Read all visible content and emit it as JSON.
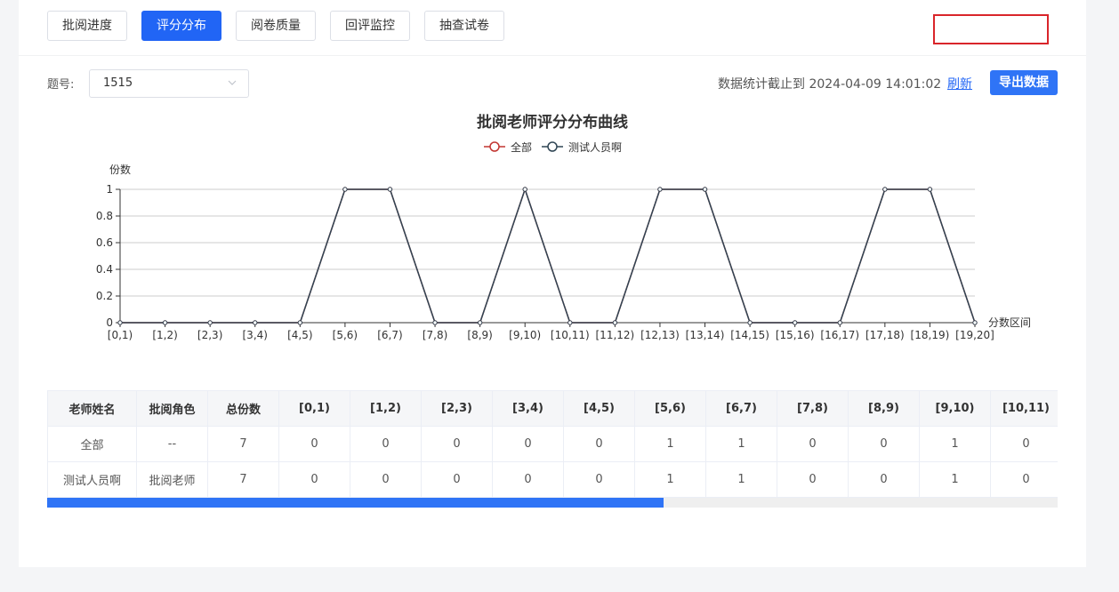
{
  "tabs": [
    {
      "label": "批阅进度",
      "active": false
    },
    {
      "label": "评分分布",
      "active": true
    },
    {
      "label": "阅卷质量",
      "active": false
    },
    {
      "label": "回评监控",
      "active": false
    },
    {
      "label": "抽查试卷",
      "active": false
    }
  ],
  "filter": {
    "question_label": "题号:",
    "question_value": "1515"
  },
  "stats": {
    "text": "数据统计截止到 2024-04-09 14:01:02",
    "refresh_label": "刷新",
    "export_label": "导出数据"
  },
  "colors": {
    "accent": "#2165f5",
    "series_all": "#c23531",
    "series_teacher": "#2f4554"
  },
  "chart_data": {
    "type": "line",
    "title": "批阅老师评分分布曲线",
    "xlabel": "分数区间",
    "ylabel": "份数",
    "ylim": [
      0,
      1
    ],
    "yticks": [
      "0",
      "0.2",
      "0.4",
      "0.6",
      "0.8",
      "1"
    ],
    "categories": [
      "[0,1)",
      "[1,2)",
      "[2,3)",
      "[3,4)",
      "[4,5)",
      "[5,6)",
      "[6,7)",
      "[7,8)",
      "[8,9)",
      "[9,10)",
      "[10,11)",
      "[11,12)",
      "[12,13)",
      "[13,14)",
      "[14,15)",
      "[15,16)",
      "[16,17)",
      "[17,18)",
      "[18,19)",
      "[19,20]"
    ],
    "series": [
      {
        "name": "全部",
        "values": [
          0,
          0,
          0,
          0,
          0,
          1,
          1,
          0,
          0,
          1,
          0,
          0,
          1,
          1,
          0,
          0,
          0,
          1,
          1,
          0
        ]
      },
      {
        "name": "测试人员啊",
        "values": [
          0,
          0,
          0,
          0,
          0,
          1,
          1,
          0,
          0,
          1,
          0,
          0,
          1,
          1,
          0,
          0,
          0,
          1,
          1,
          0
        ]
      }
    ],
    "grid": true,
    "legend": "top-center"
  },
  "table": {
    "headers": [
      "老师姓名",
      "批阅角色",
      "总份数",
      "[0,1)",
      "[1,2)",
      "[2,3)",
      "[3,4)",
      "[4,5)",
      "[5,6)",
      "[6,7)",
      "[7,8)",
      "[8,9)",
      "[9,10)",
      "[10,11)"
    ],
    "rows": [
      [
        "全部",
        "--",
        "7",
        "0",
        "0",
        "0",
        "0",
        "0",
        "1",
        "1",
        "0",
        "0",
        "1",
        "0"
      ],
      [
        "测试人员啊",
        "批阅老师",
        "7",
        "0",
        "0",
        "0",
        "0",
        "0",
        "1",
        "1",
        "0",
        "0",
        "1",
        "0"
      ]
    ],
    "scroll_position": 0.61
  }
}
